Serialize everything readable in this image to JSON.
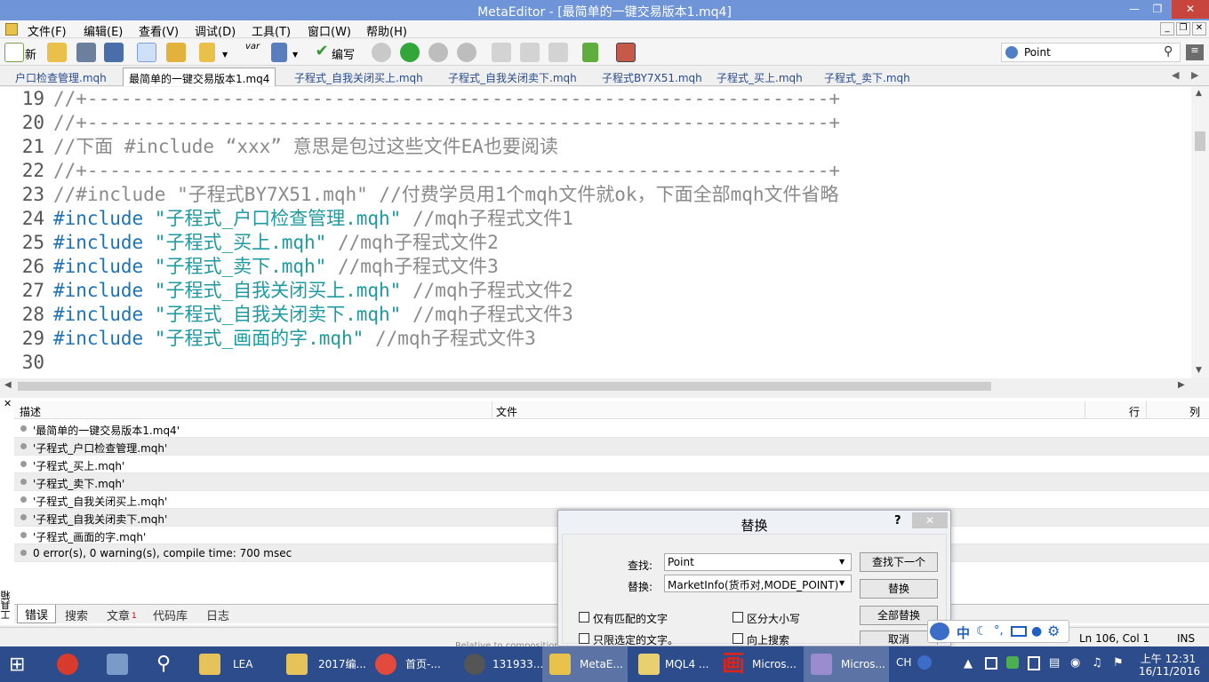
{
  "window": {
    "title": "MetaEditor - [最简单的一键交易版本1.mq4]"
  },
  "menu": [
    "文件(F)",
    "编辑(E)",
    "查看(V)",
    "调试(D)",
    "工具(T)",
    "窗口(W)",
    "帮助(H)"
  ],
  "toolbar": {
    "new_label": "新",
    "compile_label": "编写",
    "var_label": "var"
  },
  "search": {
    "value": "Point"
  },
  "tabs": [
    "户口检查管理.mqh",
    "最简单的一键交易版本1.mq4",
    "子程式_自我关闭买上.mqh",
    "子程式_自我关闭卖下.mqh",
    "子程式BY7X51.mqh",
    "子程式_买上.mqh",
    "子程式_卖下.mqh"
  ],
  "editor": {
    "lines": [
      {
        "num": "19",
        "parts": [
          {
            "t": "//+------------------------------------------------------------------+",
            "c": "cmt"
          }
        ]
      },
      {
        "num": "20",
        "parts": [
          {
            "t": "//+------------------------------------------------------------------+",
            "c": "cmt"
          }
        ]
      },
      {
        "num": "21",
        "parts": [
          {
            "t": "//下面 #include “xxx” 意思是包过这些文件EA也要阅读",
            "c": "cmt"
          }
        ]
      },
      {
        "num": "22",
        "parts": [
          {
            "t": "//+------------------------------------------------------------------+",
            "c": "cmt"
          }
        ]
      },
      {
        "num": "23",
        "parts": [
          {
            "t": "//#include \"子程式BY7X51.mqh\" //付费学员用1个mqh文件就ok，下面全部mqh文件省略",
            "c": "cmt"
          }
        ]
      },
      {
        "num": "24",
        "parts": [
          {
            "t": "#include ",
            "c": "kw"
          },
          {
            "t": "\"子程式_户口检查管理.mqh\"",
            "c": "str"
          },
          {
            "t": " //mqh子程式文件1",
            "c": "cmt"
          }
        ]
      },
      {
        "num": "25",
        "parts": [
          {
            "t": "#include ",
            "c": "kw"
          },
          {
            "t": "\"子程式_买上.mqh\"",
            "c": "str"
          },
          {
            "t": " //mqh子程式文件2",
            "c": "cmt"
          }
        ]
      },
      {
        "num": "26",
        "parts": [
          {
            "t": "#include ",
            "c": "kw"
          },
          {
            "t": "\"子程式_卖下.mqh\"",
            "c": "str"
          },
          {
            "t": " //mqh子程式文件3",
            "c": "cmt"
          }
        ]
      },
      {
        "num": "27",
        "parts": [
          {
            "t": "#include ",
            "c": "kw"
          },
          {
            "t": "\"子程式_自我关闭买上.mqh\"",
            "c": "str"
          },
          {
            "t": " //mqh子程式文件2",
            "c": "cmt"
          }
        ]
      },
      {
        "num": "28",
        "parts": [
          {
            "t": "#include ",
            "c": "kw"
          },
          {
            "t": "\"子程式_自我关闭卖下.mqh\"",
            "c": "str"
          },
          {
            "t": " //mqh子程式文件3",
            "c": "cmt"
          }
        ]
      },
      {
        "num": "29",
        "parts": [
          {
            "t": "#include ",
            "c": "kw"
          },
          {
            "t": "\"子程式_画面的字.mqh\"",
            "c": "str"
          },
          {
            "t": " //mqh子程式文件3",
            "c": "cmt"
          }
        ]
      },
      {
        "num": "30",
        "parts": []
      }
    ]
  },
  "toolbox": {
    "columns": {
      "desc": "描述",
      "file": "文件",
      "line": "行",
      "col": "列"
    },
    "rows": [
      "'最简单的一键交易版本1.mq4'",
      "'子程式_户口检查管理.mqh'",
      "'子程式_买上.mqh'",
      "'子程式_卖下.mqh'",
      "'子程式_自我关闭买上.mqh'",
      "'子程式_自我关闭卖下.mqh'",
      "'子程式_画面的字.mqh'",
      "0 error(s), 0 warning(s), compile time: 700 msec"
    ],
    "side_label": "工具箱",
    "tabs": [
      "错误",
      "搜索",
      "文章",
      "代码库",
      "日志"
    ],
    "article_badge": "1"
  },
  "dialog": {
    "title": "替换",
    "find_label": "查找:",
    "find_value": "Point",
    "replace_label": "替换:",
    "replace_value": "MarketInfo(货币对,MODE_POINT)",
    "btn_find_next": "查找下一个",
    "btn_replace": "替换",
    "btn_replace_all": "全部替换",
    "btn_cancel": "取消",
    "opt_whole": "仅有匹配的文字",
    "opt_case": "区分大小写",
    "opt_selection": "只限选定的文字。",
    "opt_up": "向上搜索",
    "help": "?"
  },
  "behind_text": "Relative to composition",
  "status": {
    "position": "Ln 106, Col 1",
    "mode": "INS"
  },
  "ime": {
    "lang": "中"
  },
  "taskbar": {
    "items": [
      "LEA",
      "2017编...",
      "首页-...",
      "131933...",
      "MetaE...",
      "MQL4 ...",
      "Micros...",
      "Micros..."
    ],
    "lang": "CH",
    "time": "上午 12:31",
    "date": "16/11/2016"
  }
}
